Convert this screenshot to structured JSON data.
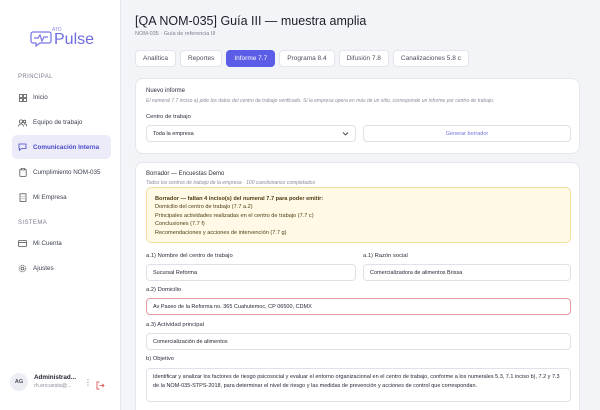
{
  "sidebar": {
    "logo_text": "Pulse",
    "logo_sub": "ATD",
    "section_principal": "PRINCIPAL",
    "section_sistema": "SISTEMA",
    "items": [
      {
        "label": "Inicio",
        "icon": "grid-icon"
      },
      {
        "label": "Equipo de trabajo",
        "icon": "users-icon"
      },
      {
        "label": "Comunicación Interna",
        "icon": "chat-icon",
        "active": true
      },
      {
        "label": "Cumplimiento NOM-035",
        "icon": "clipboard-icon"
      },
      {
        "label": "Mi Empresa",
        "icon": "building-icon"
      },
      {
        "label": "Mi Cuenta",
        "icon": "card-icon"
      },
      {
        "label": "Ajustes",
        "icon": "gear-icon"
      }
    ],
    "user": {
      "initials": "AG",
      "name": "Administrad...",
      "email": "rh.encuesta@..."
    }
  },
  "header": {
    "title": "[QA NOM-035] Guía III — muestra amplia",
    "subtitle": "NOM-035 · Guía de referencia III"
  },
  "tabs": [
    "Analítica",
    "Reportes",
    "Informe 7.7",
    "Programa 8.4",
    "Difusión 7.8",
    "Canalizaciones 5.8 c"
  ],
  "active_tab": "Informe 7.7",
  "nuevo_informe": {
    "title": "Nuevo informe",
    "note": "El numeral 7.7 inciso a) pide los datos del centro de trabajo verificado. Si la empresa opera en más de un sitio, corresponde un informe por centro de trabajo.",
    "center_label": "Centro de trabajo",
    "center_value": "Toda la empresa",
    "generate_label": "Generar borrador"
  },
  "borrador": {
    "title": "Borrador — Encuestas Demo",
    "note": "Todos los centros de trabajo de la empresa · 100 cuestionarios completados",
    "warning_title": "Borrador — faltan 4 inciso(s) del numeral 7.7 para poder emitir:",
    "warning_items": [
      "Domicilio del centro de trabajo (7.7 a.2)",
      "Principales actividades realizadas en el centro de trabajo (7.7 c)",
      "Conclusiones (7.7 f)",
      "Recomendaciones y acciones de intervención (7.7 g)"
    ],
    "fields": {
      "a1_name_label": "a.1) Nombre del centro de trabajo",
      "a1_name_value": "Sucursal Reforma",
      "a1_social_label": "a.1) Razón social",
      "a1_social_value": "Comercializadora de alimentos Brissa",
      "a2_label": "a.2) Domicilio",
      "a2_value": "Av Paseo de la Reforma no. 365 Cuahutemoc, CP 06500, CDMX",
      "a3_label": "a.3) Actividad principal",
      "a3_value": "Comercialización de alimentos",
      "b_label": "b) Objetivo",
      "b_value": "Identificar y analizar los factores de riesgo psicosocial y evaluar el entorno organizacional en el centro de trabajo, conforme a los numerales 5.3, 7.1 inciso b), 7.2 y 7.3 de la NOM-035-STPS-2018, para determinar el nivel de riesgo y las medidas de prevención y acciones de control que correspondan."
    }
  },
  "colors": {
    "accent": "#5b5de6",
    "warning_bg": "#fff9e6",
    "error_border": "#e49ca0"
  }
}
